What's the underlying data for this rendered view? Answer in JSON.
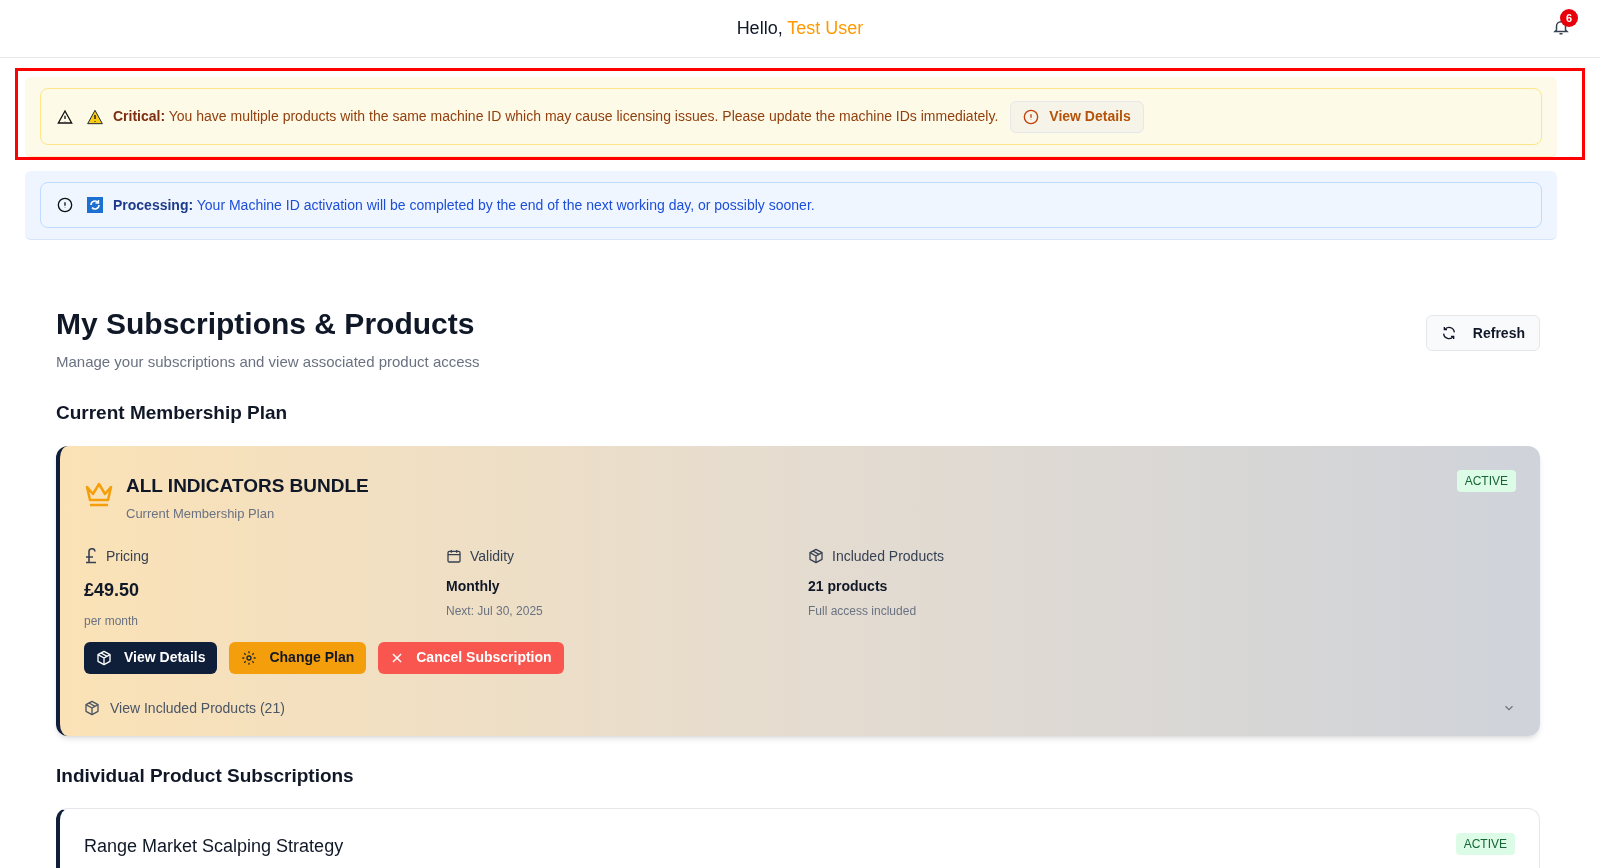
{
  "header": {
    "greeting": "Hello,",
    "user": "Test User",
    "notifications": "6"
  },
  "alerts": [
    {
      "kind": "critical",
      "highlighted": true,
      "label": "Critical:",
      "message": "You have multiple products with the same machine ID which may cause licensing issues. Please update the machine IDs immediately.",
      "button": "View Details"
    },
    {
      "kind": "processing",
      "highlighted": false,
      "label": "Processing:",
      "message": "Your Machine ID activation will be completed by the end of the next working day, or possibly sooner."
    }
  ],
  "page": {
    "title": "My Subscriptions & Products",
    "subtitle": "Manage your subscriptions and view associated product access",
    "refresh": "Refresh"
  },
  "membership": {
    "heading": "Current Membership Plan",
    "name": "ALL INDICATORS BUNDLE",
    "subtitle": "Current Membership Plan",
    "status": "ACTIVE",
    "stats": [
      {
        "kind": "pricing",
        "label": "Pricing",
        "value": "£49.50",
        "note": "per month"
      },
      {
        "kind": "validity",
        "label": "Validity",
        "value": "Monthly",
        "note": "Next: Jul 30, 2025"
      },
      {
        "kind": "products",
        "label": "Included Products",
        "value": "21 products",
        "note": "Full access included"
      }
    ],
    "actions": [
      {
        "kind": "details",
        "label": "View Details"
      },
      {
        "kind": "change",
        "label": "Change Plan"
      },
      {
        "kind": "cancel",
        "label": "Cancel Subscription"
      }
    ],
    "expander": {
      "label": "View Included Products (21)",
      "expanded": false
    }
  },
  "individual": {
    "heading": "Individual Product Subscriptions",
    "products": [
      {
        "name": "Range Market Scalping Strategy",
        "status": "ACTIVE"
      }
    ]
  }
}
